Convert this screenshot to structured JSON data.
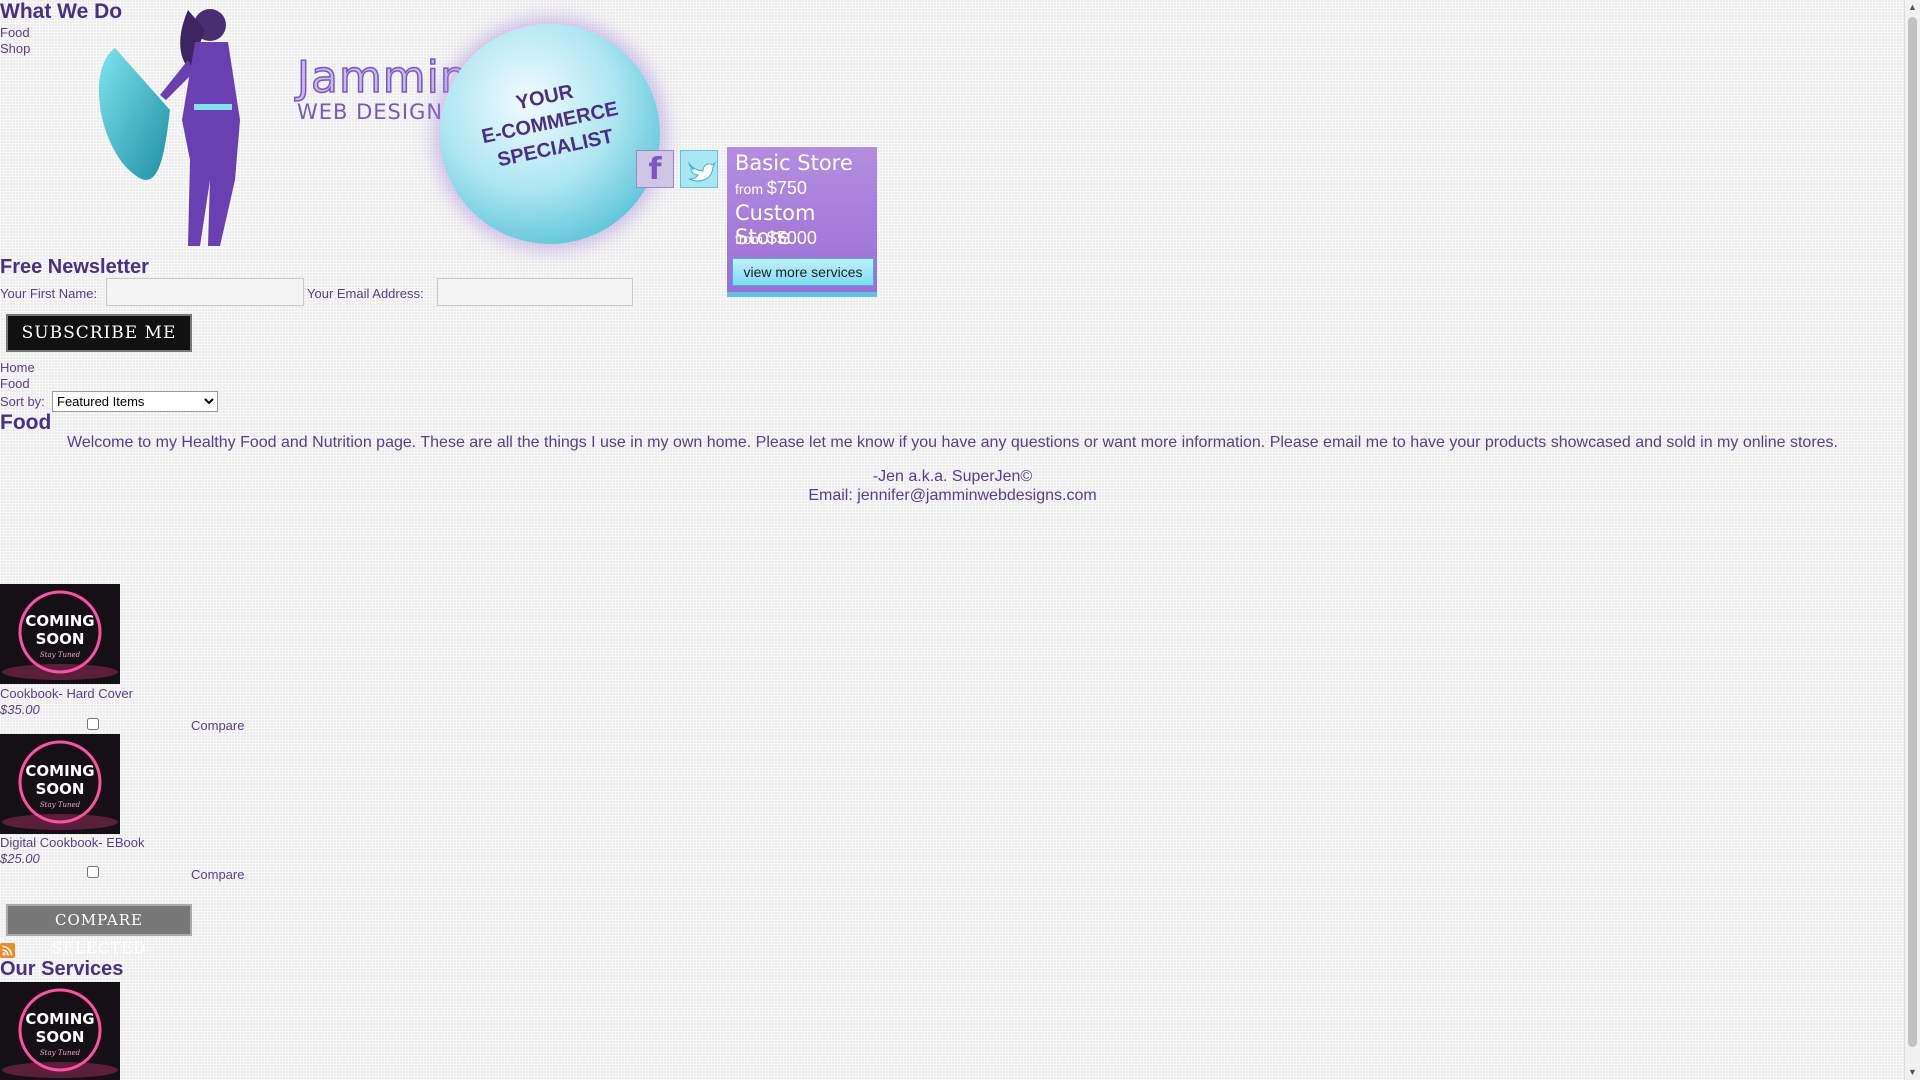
{
  "what_we_do": {
    "title": "What We Do",
    "links": [
      "Food",
      "Shop"
    ]
  },
  "logo": {
    "brand_main": "Jammin",
    "brand_sub": "WEB DESIGNS",
    "tagline_lines": [
      "YOUR",
      "E-COMMERCE",
      "SPECIALIST"
    ]
  },
  "social": {
    "facebook": "f"
  },
  "promo": {
    "basic_label": "Basic Store",
    "basic_from": "from",
    "basic_price": "$750",
    "custom_label": "Custom Store",
    "custom_from": "from",
    "custom_price": "$5000",
    "view_more": "view more services"
  },
  "newsletter": {
    "title": "Free Newsletter",
    "first_name_label": "Your First Name:",
    "email_label": "Your Email Address:",
    "subscribe_button": "SUBSCRIBE ME"
  },
  "breadcrumb": [
    "Home",
    "Food"
  ],
  "sort": {
    "label": "Sort by:",
    "selected": "Featured Items"
  },
  "category": {
    "title": "Food",
    "description": "Welcome to my Healthy Food and Nutrition page. These are all the things I use in my own home. Please let me know if you have any questions or want more information. Please email me to have your products showcased and sold in my online stores.",
    "signature": "-Jen  a.k.a. SuperJen©",
    "email_line": "Email: jennifer@jamminwebdesigns.com"
  },
  "coming_soon": {
    "line1": "COMING",
    "line2": "SOON",
    "script": "Stay Tuned"
  },
  "products": [
    {
      "title": "Cookbook- Hard Cover",
      "price": "$35.00",
      "compare": "Compare"
    },
    {
      "title": "Digital Cookbook- EBook",
      "price": "$25.00",
      "compare": "Compare"
    }
  ],
  "compare_selected_button": "COMPARE SELECTED",
  "our_services": {
    "title": "Our Services"
  },
  "colors": {
    "accent": "#5a3d8c",
    "promo": "#a67ddb",
    "cyan": "#5bc6dd"
  }
}
